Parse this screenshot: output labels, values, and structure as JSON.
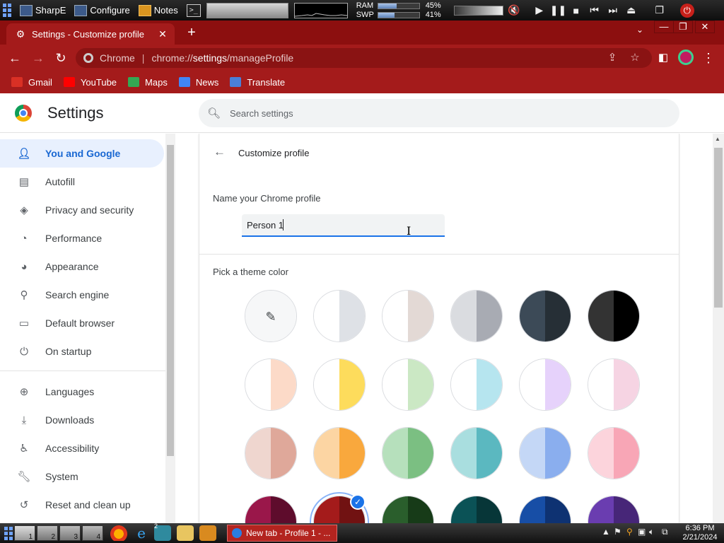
{
  "system_bar": {
    "apps": [
      {
        "label": "SharpE",
        "icon": "monitor-icon"
      },
      {
        "label": "Configure",
        "icon": "monitor-icon"
      },
      {
        "label": "Notes",
        "icon": "notes-icon"
      }
    ],
    "terminal_icon": ">_",
    "ram_label": "RAM",
    "ram_pct": "45%",
    "ram_fill": 0.45,
    "swp_label": "SWP",
    "swp_pct": "41%",
    "swp_fill": 0.41,
    "media_controls": [
      "▶",
      "❚❚",
      "■",
      "⏮",
      "⏭"
    ]
  },
  "browser": {
    "tab_title": "Settings - Customize profile",
    "tab_icon": "gear-icon",
    "omnibox_label": "Chrome",
    "url_prefix": "chrome://",
    "url_host": "settings",
    "url_path": "/manageProfile",
    "bookmarks": [
      {
        "label": "Gmail",
        "color": "#d93025"
      },
      {
        "label": "YouTube",
        "color": "#ff0000"
      },
      {
        "label": "Maps",
        "color": "#34a853"
      },
      {
        "label": "News",
        "color": "#4285f4"
      },
      {
        "label": "Translate",
        "color": "#4a7fd8"
      }
    ],
    "frame_color": "#a41b1b"
  },
  "settings": {
    "title": "Settings",
    "search_placeholder": "Search settings",
    "nav": [
      {
        "label": "You and Google",
        "icon": "person-icon",
        "active": true
      },
      {
        "label": "Autofill",
        "icon": "clipboard-icon"
      },
      {
        "label": "Privacy and security",
        "icon": "shield-icon"
      },
      {
        "label": "Performance",
        "icon": "speedometer-icon"
      },
      {
        "label": "Appearance",
        "icon": "palette-icon"
      },
      {
        "label": "Search engine",
        "icon": "search-icon"
      },
      {
        "label": "Default browser",
        "icon": "browser-icon"
      },
      {
        "label": "On startup",
        "icon": "power-icon"
      },
      {
        "label": "Languages",
        "icon": "globe-icon"
      },
      {
        "label": "Downloads",
        "icon": "download-icon"
      },
      {
        "label": "Accessibility",
        "icon": "accessibility-icon"
      },
      {
        "label": "System",
        "icon": "wrench-icon"
      },
      {
        "label": "Reset and clean up",
        "icon": "history-icon"
      }
    ],
    "page_title": "Customize profile",
    "name_label": "Name your Chrome profile",
    "name_value": "Person 1",
    "theme_label": "Pick a theme color",
    "theme_colors": [
      [
        [
          "custom",
          "custom"
        ],
        [
          "#ffffff",
          "#dee1e6"
        ],
        [
          "#ffffff",
          "#e3d9d5"
        ],
        [
          "#dadce0",
          "#a8abb3"
        ],
        [
          "#3c4a57",
          "#262f36"
        ],
        [
          "#333333",
          "#000000"
        ]
      ],
      [
        [
          "#ffffff",
          "#fcdac8"
        ],
        [
          "#ffffff",
          "#fddc5c"
        ],
        [
          "#ffffff",
          "#cbe8c4"
        ],
        [
          "#ffffff",
          "#b6e5ef"
        ],
        [
          "#ffffff",
          "#e6d2fb"
        ],
        [
          "#ffffff",
          "#f6d4e3"
        ]
      ],
      [
        [
          "#efd6cf",
          "#dfa89a"
        ],
        [
          "#fcd5a3",
          "#f9a83d"
        ],
        [
          "#b6e0bc",
          "#7bbf82"
        ],
        [
          "#a9dedf",
          "#5bb8c0"
        ],
        [
          "#c4d7f6",
          "#8aaeee"
        ],
        [
          "#fcd4dc",
          "#f8a6b6"
        ]
      ],
      [
        [
          "#9a174a",
          "#5e0c2c"
        ],
        [
          "#a41b1b",
          "#711212"
        ],
        [
          "#2a5e2c",
          "#173b18"
        ],
        [
          "#0b5256",
          "#073638"
        ],
        [
          "#174ea6",
          "#0e3272"
        ],
        [
          "#6a3db0",
          "#472678"
        ]
      ]
    ],
    "selected_theme": "#a41b1b"
  },
  "taskbar": {
    "workspaces": [
      "1",
      "2",
      "3",
      "4"
    ],
    "window_title": "New tab - Profile 1 - ...",
    "time": "6:36 PM",
    "date": "2/21/2024",
    "badge": "2"
  }
}
